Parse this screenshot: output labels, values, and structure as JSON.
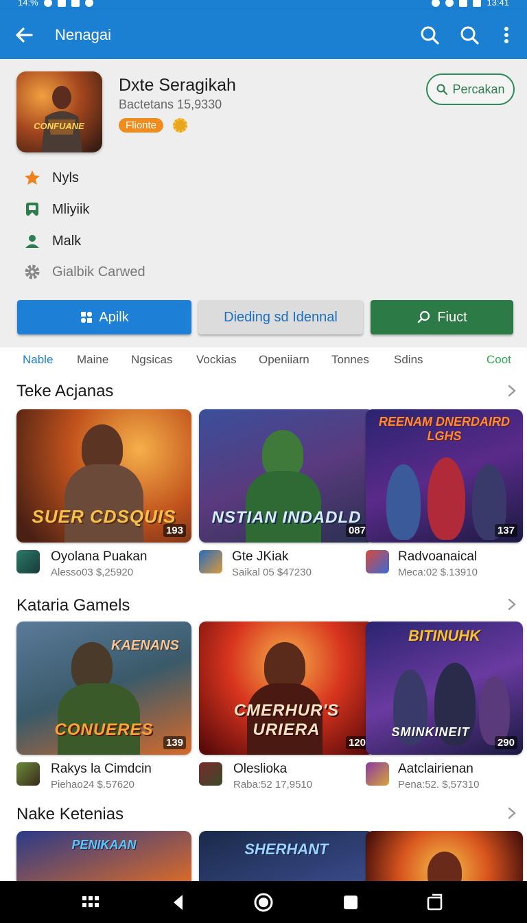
{
  "status_bar": {
    "left_text": "14:%",
    "right_text": "13:41"
  },
  "app_bar": {
    "title": "Nenagai",
    "back_icon": "back-arrow-icon",
    "icons": [
      "search-icon",
      "search-icon",
      "more-vert-icon"
    ]
  },
  "header": {
    "app_name": "Dxte Seragikah",
    "app_subtitle": "Bactetans 15,9330",
    "badge": "Flionte",
    "badge_icon": "sun-icon",
    "outline_button": "Percakan",
    "icon_art_text": "CONFUANE",
    "menu": [
      {
        "label": "Nyls",
        "icon": "star-icon",
        "color": "#f0821e"
      },
      {
        "label": "Mliyiik",
        "icon": "bookmark-icon",
        "color": "#2e7d4f"
      },
      {
        "label": "Malk",
        "icon": "person-icon",
        "color": "#2e7d4f"
      },
      {
        "label": "Gialbik Carwed",
        "icon": "gear-icon",
        "color": "#888888"
      }
    ],
    "buttons": {
      "primary": "Apilk",
      "secondary": "Dieding sd Idennal",
      "tertiary": "Fiuct"
    }
  },
  "tabs": [
    "Nable",
    "Maine",
    "Ngsicas",
    "Vockias",
    "Openiiarn",
    "Tonnes",
    "Sdins",
    "Coot"
  ],
  "sections": [
    {
      "title": "Teke Acjanas",
      "cards": [
        {
          "art_title": "SUER CDSQUIS",
          "art_top": "",
          "count": "193",
          "title": "Oyolana Puakan",
          "sub": "Alesso03 $,25920"
        },
        {
          "art_title": "NSTIAN INDADLD",
          "art_top": "",
          "count": "087",
          "title": "Gte JKiak",
          "sub": "Saikal 05 $47230"
        },
        {
          "art_title": "",
          "art_top": "REENAM DNERDAIRD LGHS",
          "count": "137",
          "title": "Radvoanaical",
          "sub": "Meca:02 $.13910"
        }
      ]
    },
    {
      "title": "Kataria Gamels",
      "cards": [
        {
          "art_title": "CONUERES",
          "art_top": "KAENANS",
          "count": "139",
          "title": "Rakys la Cimdcin",
          "sub": "Piehao24 $.57620"
        },
        {
          "art_title": "CMERHUR'S URIERA",
          "art_top": "",
          "count": "120",
          "title": "Oleslioka",
          "sub": "Raba:52 17,9510"
        },
        {
          "art_title": "SMINKINEIT",
          "art_top": "BITINUHK",
          "count": "290",
          "title": "Aatclairienan",
          "sub": "Pena:52. $,57310"
        }
      ]
    },
    {
      "title": "Nake Ketenias",
      "cards": [
        {
          "art_title": "",
          "art_top": "PENIKAAN",
          "count": "",
          "title": "",
          "sub": ""
        },
        {
          "art_title": "",
          "art_top": "SHERHANT",
          "count": "",
          "title": "",
          "sub": ""
        },
        {
          "art_title": "",
          "art_top": "",
          "count": "",
          "title": "",
          "sub": ""
        }
      ]
    }
  ],
  "nav_bar": {
    "icons": [
      "apps-grid-icon",
      "back-triangle-icon",
      "home-circle-icon",
      "recents-square-icon",
      "rotate-icon"
    ]
  },
  "colors": {
    "primary": "#1b7fd2",
    "green": "#2c7a45",
    "orange": "#f08c1c"
  }
}
